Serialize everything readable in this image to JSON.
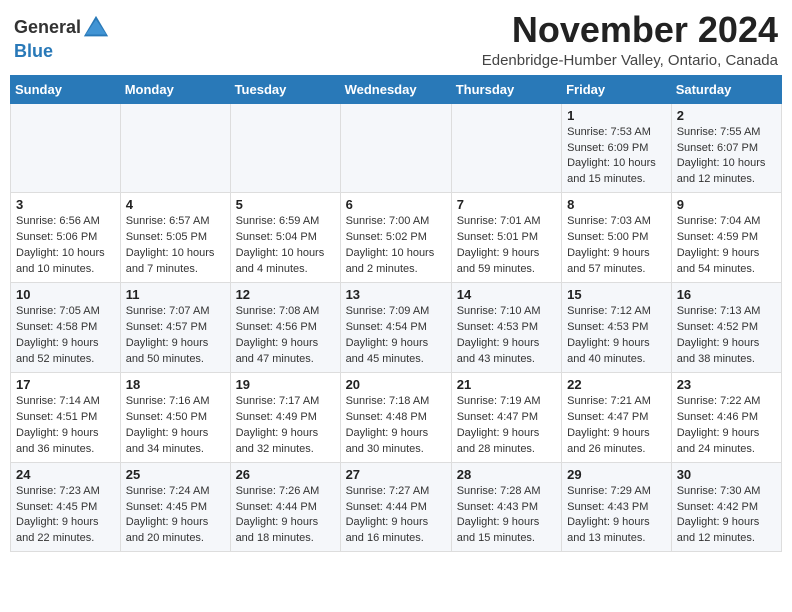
{
  "header": {
    "logo": {
      "line1": "General",
      "line2": "Blue"
    },
    "title": "November 2024",
    "location": "Edenbridge-Humber Valley, Ontario, Canada"
  },
  "weekdays": [
    "Sunday",
    "Monday",
    "Tuesday",
    "Wednesday",
    "Thursday",
    "Friday",
    "Saturday"
  ],
  "weeks": [
    [
      {
        "day": "",
        "info": ""
      },
      {
        "day": "",
        "info": ""
      },
      {
        "day": "",
        "info": ""
      },
      {
        "day": "",
        "info": ""
      },
      {
        "day": "",
        "info": ""
      },
      {
        "day": "1",
        "info": "Sunrise: 7:53 AM\nSunset: 6:09 PM\nDaylight: 10 hours and 15 minutes."
      },
      {
        "day": "2",
        "info": "Sunrise: 7:55 AM\nSunset: 6:07 PM\nDaylight: 10 hours and 12 minutes."
      }
    ],
    [
      {
        "day": "3",
        "info": "Sunrise: 6:56 AM\nSunset: 5:06 PM\nDaylight: 10 hours and 10 minutes."
      },
      {
        "day": "4",
        "info": "Sunrise: 6:57 AM\nSunset: 5:05 PM\nDaylight: 10 hours and 7 minutes."
      },
      {
        "day": "5",
        "info": "Sunrise: 6:59 AM\nSunset: 5:04 PM\nDaylight: 10 hours and 4 minutes."
      },
      {
        "day": "6",
        "info": "Sunrise: 7:00 AM\nSunset: 5:02 PM\nDaylight: 10 hours and 2 minutes."
      },
      {
        "day": "7",
        "info": "Sunrise: 7:01 AM\nSunset: 5:01 PM\nDaylight: 9 hours and 59 minutes."
      },
      {
        "day": "8",
        "info": "Sunrise: 7:03 AM\nSunset: 5:00 PM\nDaylight: 9 hours and 57 minutes."
      },
      {
        "day": "9",
        "info": "Sunrise: 7:04 AM\nSunset: 4:59 PM\nDaylight: 9 hours and 54 minutes."
      }
    ],
    [
      {
        "day": "10",
        "info": "Sunrise: 7:05 AM\nSunset: 4:58 PM\nDaylight: 9 hours and 52 minutes."
      },
      {
        "day": "11",
        "info": "Sunrise: 7:07 AM\nSunset: 4:57 PM\nDaylight: 9 hours and 50 minutes."
      },
      {
        "day": "12",
        "info": "Sunrise: 7:08 AM\nSunset: 4:56 PM\nDaylight: 9 hours and 47 minutes."
      },
      {
        "day": "13",
        "info": "Sunrise: 7:09 AM\nSunset: 4:54 PM\nDaylight: 9 hours and 45 minutes."
      },
      {
        "day": "14",
        "info": "Sunrise: 7:10 AM\nSunset: 4:53 PM\nDaylight: 9 hours and 43 minutes."
      },
      {
        "day": "15",
        "info": "Sunrise: 7:12 AM\nSunset: 4:53 PM\nDaylight: 9 hours and 40 minutes."
      },
      {
        "day": "16",
        "info": "Sunrise: 7:13 AM\nSunset: 4:52 PM\nDaylight: 9 hours and 38 minutes."
      }
    ],
    [
      {
        "day": "17",
        "info": "Sunrise: 7:14 AM\nSunset: 4:51 PM\nDaylight: 9 hours and 36 minutes."
      },
      {
        "day": "18",
        "info": "Sunrise: 7:16 AM\nSunset: 4:50 PM\nDaylight: 9 hours and 34 minutes."
      },
      {
        "day": "19",
        "info": "Sunrise: 7:17 AM\nSunset: 4:49 PM\nDaylight: 9 hours and 32 minutes."
      },
      {
        "day": "20",
        "info": "Sunrise: 7:18 AM\nSunset: 4:48 PM\nDaylight: 9 hours and 30 minutes."
      },
      {
        "day": "21",
        "info": "Sunrise: 7:19 AM\nSunset: 4:47 PM\nDaylight: 9 hours and 28 minutes."
      },
      {
        "day": "22",
        "info": "Sunrise: 7:21 AM\nSunset: 4:47 PM\nDaylight: 9 hours and 26 minutes."
      },
      {
        "day": "23",
        "info": "Sunrise: 7:22 AM\nSunset: 4:46 PM\nDaylight: 9 hours and 24 minutes."
      }
    ],
    [
      {
        "day": "24",
        "info": "Sunrise: 7:23 AM\nSunset: 4:45 PM\nDaylight: 9 hours and 22 minutes."
      },
      {
        "day": "25",
        "info": "Sunrise: 7:24 AM\nSunset: 4:45 PM\nDaylight: 9 hours and 20 minutes."
      },
      {
        "day": "26",
        "info": "Sunrise: 7:26 AM\nSunset: 4:44 PM\nDaylight: 9 hours and 18 minutes."
      },
      {
        "day": "27",
        "info": "Sunrise: 7:27 AM\nSunset: 4:44 PM\nDaylight: 9 hours and 16 minutes."
      },
      {
        "day": "28",
        "info": "Sunrise: 7:28 AM\nSunset: 4:43 PM\nDaylight: 9 hours and 15 minutes."
      },
      {
        "day": "29",
        "info": "Sunrise: 7:29 AM\nSunset: 4:43 PM\nDaylight: 9 hours and 13 minutes."
      },
      {
        "day": "30",
        "info": "Sunrise: 7:30 AM\nSunset: 4:42 PM\nDaylight: 9 hours and 12 minutes."
      }
    ]
  ]
}
